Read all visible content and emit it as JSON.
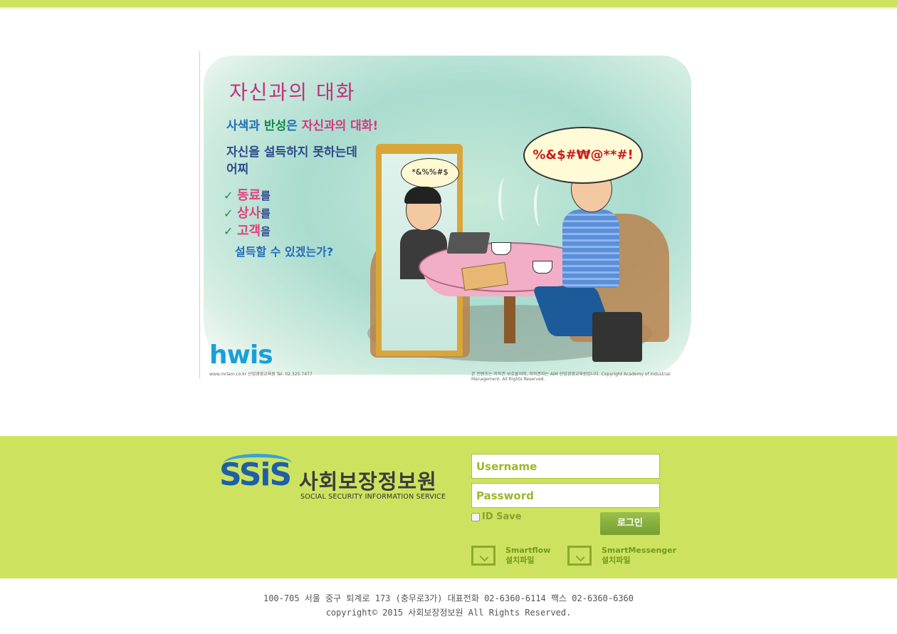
{
  "poster": {
    "title": "자신과의 대화",
    "line1_a": "사색",
    "line1_b": "과",
    "line1_c": "반성",
    "line1_d": "은",
    "line1_e": "자신과의 대화!",
    "line2": "자신을 설득하지 못하는데",
    "line3": "어찌",
    "items": [
      {
        "check": "✓",
        "big": "동료",
        "small": "를"
      },
      {
        "check": "✓",
        "big": "상사",
        "small": "를"
      },
      {
        "check": "✓",
        "big": "고객",
        "small": "을"
      }
    ],
    "last": "설득할 수 있겠는가?",
    "bubble": "%&$#₩@**#!",
    "mirror_bubble": "*&%%#$",
    "brand": "hwis",
    "foot_left": "www.mrlam.co.kr  산업경영교육원  Tel. 02.325.7477",
    "foot_right": "본 컨텐츠는 저작권 보호물이며, 저작권자는 AIM 산업경영교육원입니다.  Copyright Academy of Industrial Management. All Rights Reserved."
  },
  "logo": {
    "mark": "SSiS",
    "korean": "사회보장정보원",
    "english": "SOCIAL SECURITY INFORMATION SERVICE"
  },
  "login": {
    "username_placeholder": "Username",
    "password_placeholder": "Password",
    "id_save": "ID Save",
    "login_button": "로그인"
  },
  "downloads": [
    {
      "name": "Smartflow",
      "label": "설치파일"
    },
    {
      "name": "SmartMessenger",
      "label": "설치파일"
    }
  ],
  "footer": {
    "address": "100-705 서울 중구 퇴계로 173 (충무로3가) 대표전화 02-6360-6114 팩스 02-6360-6360",
    "copyright": "copyright© 2015 사회보장정보원 All Rights Reserved."
  },
  "colors": {
    "band": "#cde35f",
    "accent": "#8aab26"
  }
}
